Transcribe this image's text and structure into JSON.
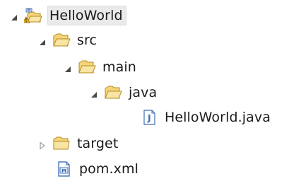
{
  "tree": {
    "project": {
      "label": "HelloWorld",
      "icon": "maven-project-warning-icon",
      "expanded": true,
      "selected": true
    },
    "src": {
      "label": "src",
      "icon": "folder-open-icon",
      "expanded": true
    },
    "main": {
      "label": "main",
      "icon": "folder-open-icon",
      "expanded": true
    },
    "java": {
      "label": "java",
      "icon": "folder-open-icon",
      "expanded": true
    },
    "java_file": {
      "label": "HelloWorld.java",
      "icon": "java-file-icon"
    },
    "target": {
      "label": "target",
      "icon": "folder-icon",
      "expanded": false
    },
    "pom": {
      "label": "pom.xml",
      "icon": "maven-pom-icon"
    }
  },
  "colors": {
    "folder_fill": "#f4d57a",
    "folder_stroke": "#b58a1f",
    "expanded_toggle": "#4a4a4a",
    "collapsed_toggle": "#8a8a8a",
    "java_accent": "#3f6fb6",
    "maven_accent": "#2f5fae",
    "warning": "#f2b320"
  }
}
